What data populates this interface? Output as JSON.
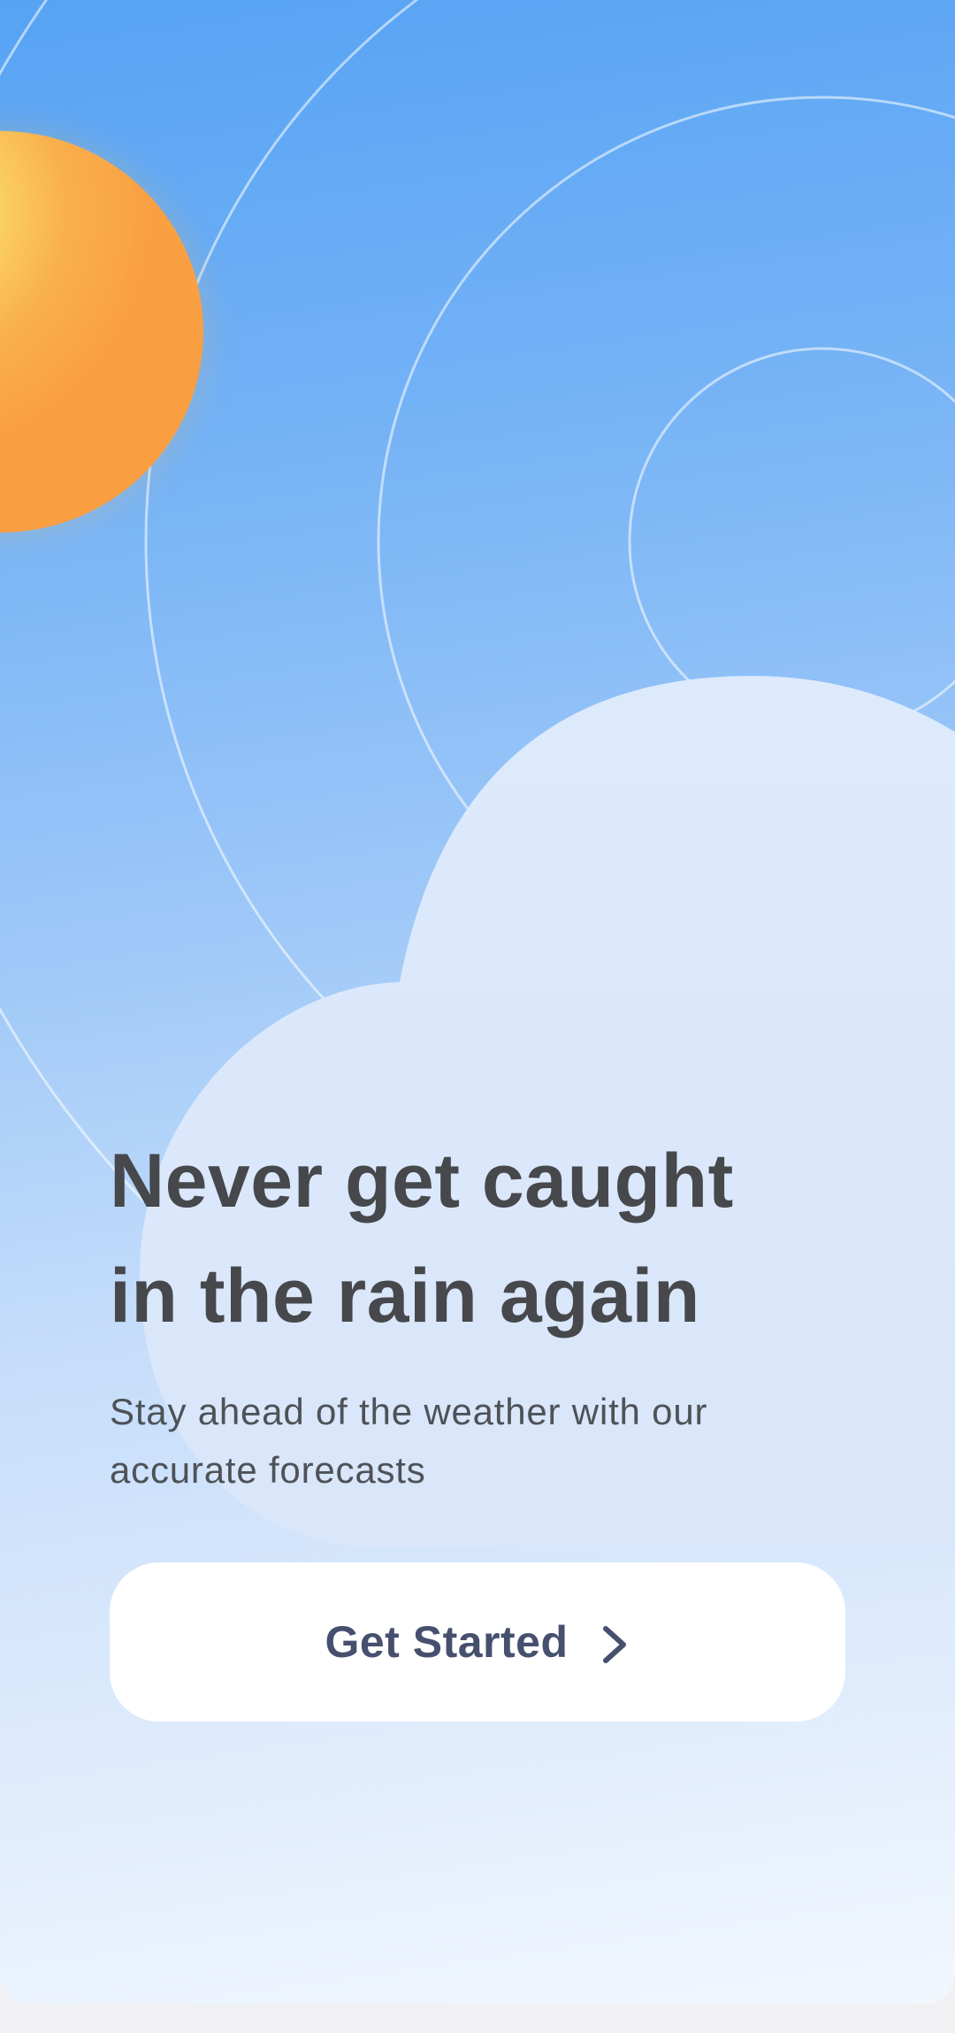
{
  "onboarding": {
    "headline_line1": "Never get caught",
    "headline_line2": "in the rain again",
    "subtitle_line1": "Stay ahead of the weather with our",
    "subtitle_line2": "accurate forecasts",
    "cta_label": "Get Started",
    "cta_icon": "chevron-right-icon"
  },
  "illustration": {
    "sun_icon": "sun-icon",
    "cloud_icon": "cloud-icon",
    "rings": "radar-rings"
  },
  "colors": {
    "sky_top": "#56a3f4",
    "sky_bottom": "#f2f7fe",
    "sun": "#f99e42",
    "sun_highlight": "#fbe878",
    "cloud": "#dae8fb",
    "text_primary": "#46484c",
    "button_bg": "#ffffff",
    "button_text": "#46506e"
  }
}
